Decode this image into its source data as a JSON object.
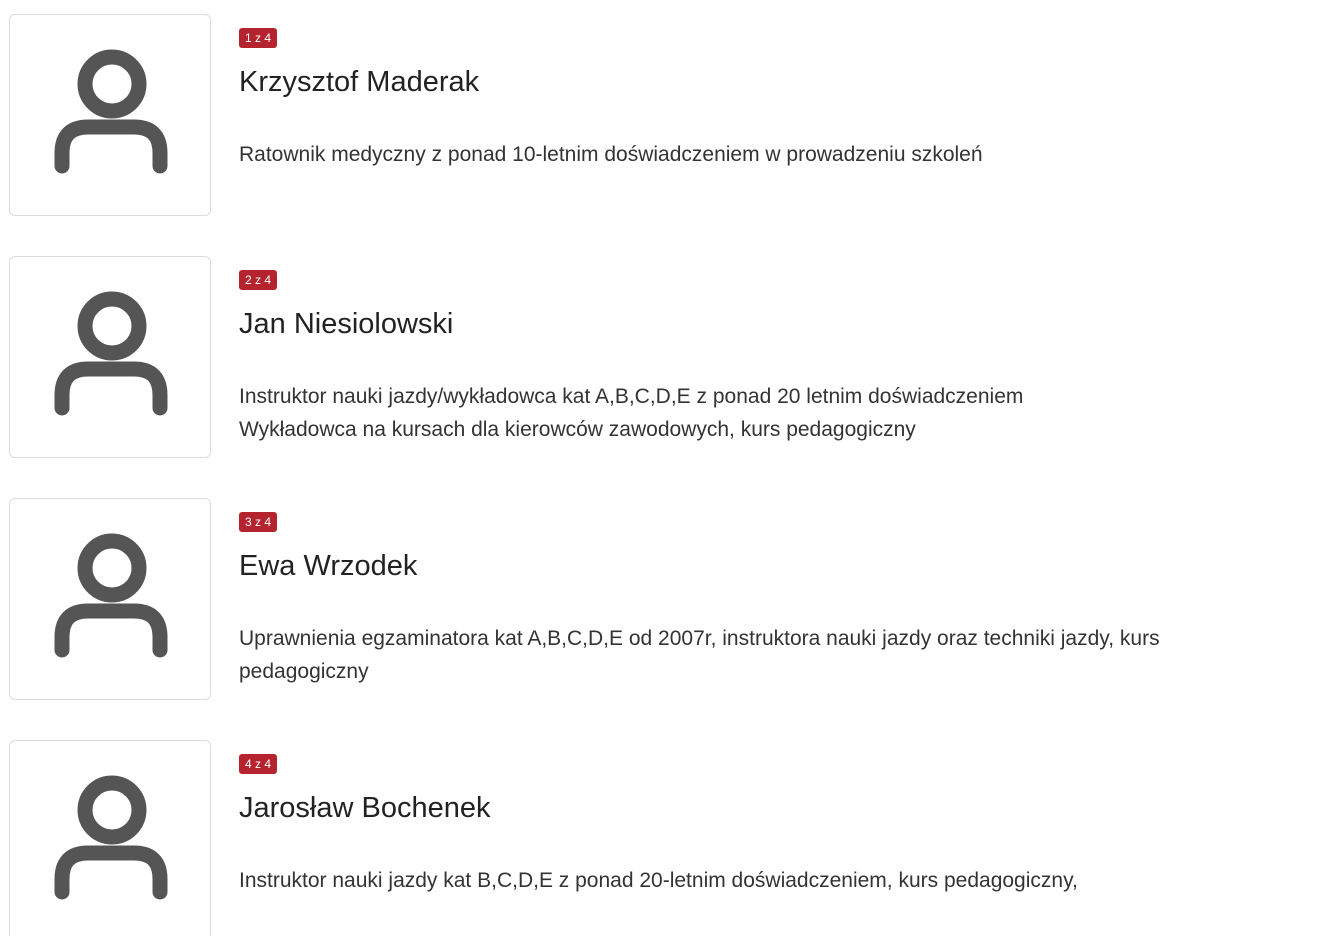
{
  "colors": {
    "badge_bg": "#b5232f",
    "badge_text": "#ffffff",
    "icon": "#555555",
    "border": "#dcdcdc"
  },
  "people": [
    {
      "counter": "1 z 4",
      "name": "Krzysztof Maderak",
      "description": "Ratownik medyczny z ponad 10-letnim doświadczeniem w prowadzeniu szkoleń",
      "avatar_icon": "user-icon"
    },
    {
      "counter": "2 z 4",
      "name": "Jan Niesiolowski",
      "description": "Instruktor nauki jazdy/wykładowca kat A,B,C,D,E z ponad 20 letnim doświadczeniem\nWykładowca na kursach dla kierowców zawodowych, kurs pedagogiczny",
      "avatar_icon": "user-icon"
    },
    {
      "counter": "3 z 4",
      "name": "Ewa Wrzodek",
      "description": "Uprawnienia egzaminatora kat A,B,C,D,E od 2007r, instruktora nauki jazdy oraz techniki jazdy, kurs\npedagogiczny",
      "avatar_icon": "user-icon"
    },
    {
      "counter": "4 z 4",
      "name": "Jarosław Bochenek",
      "description": "Instruktor nauki jazdy kat B,C,D,E z ponad 20-letnim doświadczeniem, kurs pedagogiczny,",
      "avatar_icon": "user-icon"
    }
  ]
}
